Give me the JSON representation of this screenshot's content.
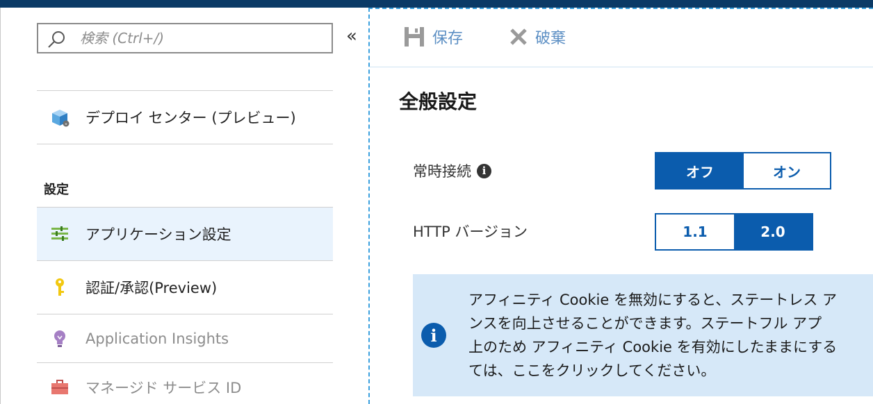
{
  "left": {
    "search_placeholder": "検索 (Ctrl+/)",
    "collapse_glyph": "«",
    "items": [
      {
        "label": "デプロイ センター (プレビュー)",
        "icon": "deploy-box-icon"
      },
      {
        "label": "アプリケーション設定",
        "icon": "app-settings-icon"
      },
      {
        "label": "認証/承認(Preview)",
        "icon": "key-icon"
      },
      {
        "label": "Application Insights",
        "icon": "lightbulb-icon"
      },
      {
        "label": "マネージド サービス ID",
        "icon": "toolbox-icon"
      }
    ],
    "section_heading": "設定"
  },
  "toolbar": {
    "save_label": "保存",
    "discard_label": "破棄"
  },
  "main": {
    "title": "全般設定",
    "always_on": {
      "label": "常時接続",
      "options": [
        "オフ",
        "オン"
      ],
      "selected": "オフ"
    },
    "http_version": {
      "label": "HTTP バージョン",
      "options": [
        "1.1",
        "2.0"
      ],
      "selected": "2.0"
    },
    "info": {
      "lines": [
        "アフィニティ Cookie を無効にすると、ステートレス ア",
        "ンスを向上させることができます。ステートフル アプ",
        "上のため アフィニティ Cookie を有効にしたままにする",
        "ては、ここをクリックしてください。"
      ]
    }
  },
  "colors": {
    "accent": "#0b5cad",
    "selected_nav_bg": "#e9f3fd",
    "info_bg": "#d6e8f8",
    "topbar": "#0b3a66"
  }
}
